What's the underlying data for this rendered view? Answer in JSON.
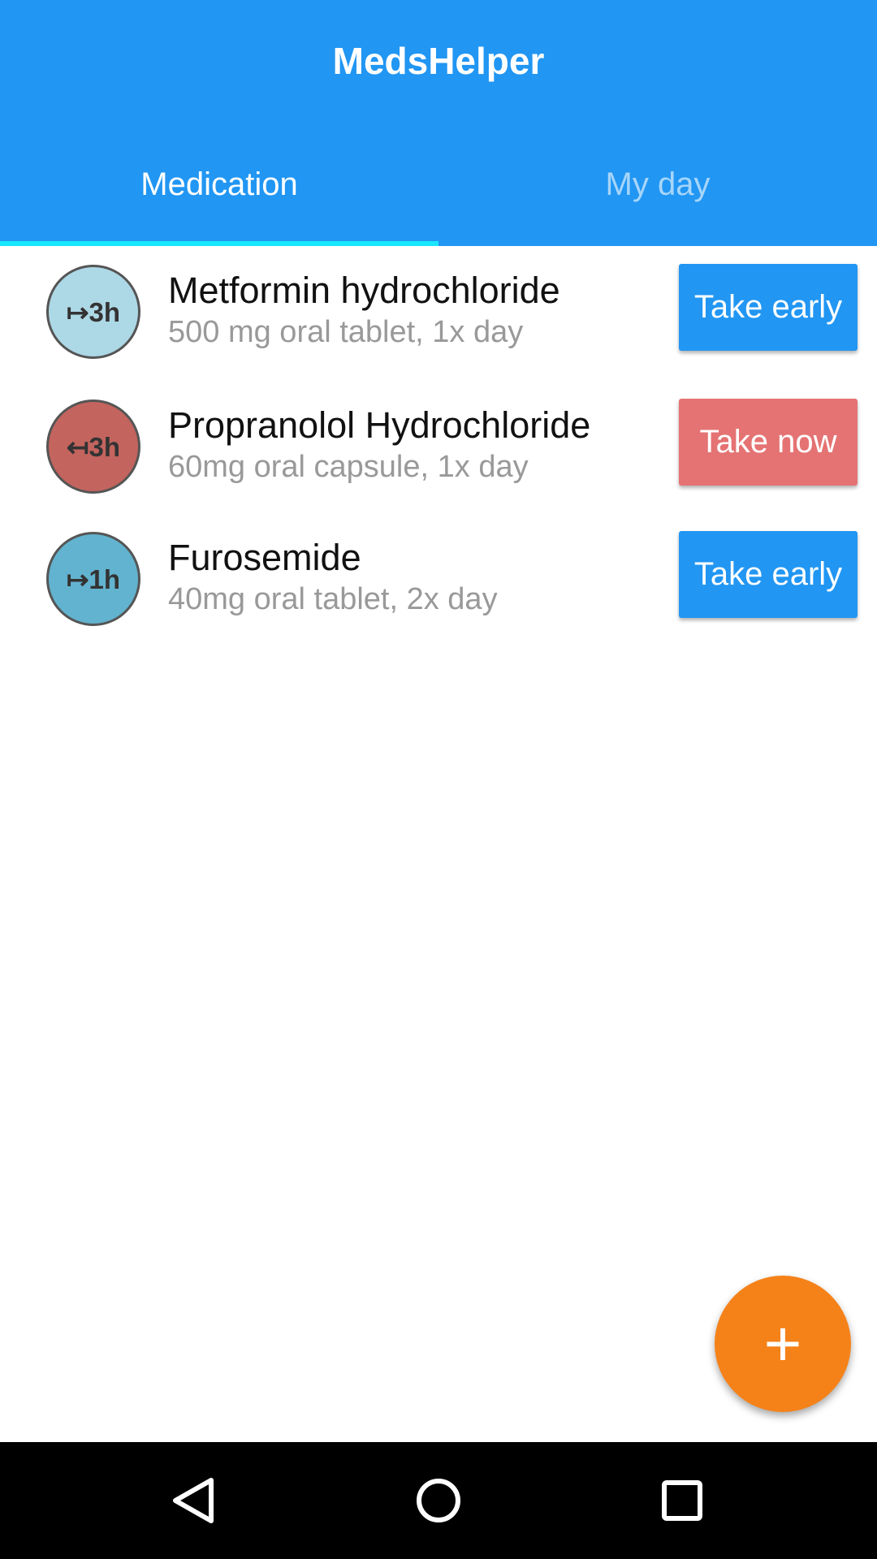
{
  "app": {
    "title": "MedsHelper"
  },
  "tabs": [
    {
      "label": "Medication",
      "active": true
    },
    {
      "label": "My day",
      "active": false
    }
  ],
  "medications": [
    {
      "badge": "↦3h",
      "name": "Metformin hydrochloride",
      "detail": "500 mg oral tablet, 1x day",
      "action": "Take early",
      "badge_color": "#ADD8E6",
      "button_color": "#2196F3"
    },
    {
      "badge": "↤3h",
      "name": "Propranolol Hydrochloride",
      "detail": "60mg oral capsule, 1x day",
      "action": "Take now",
      "badge_color": "#C4645E",
      "button_color": "#E57373"
    },
    {
      "badge": "↦1h",
      "name": "Furosemide",
      "detail": "40mg oral tablet, 2x day",
      "action": "Take early",
      "badge_color": "#62B3CF",
      "button_color": "#2196F3"
    }
  ],
  "fab": {
    "icon": "plus-icon",
    "label": "+"
  },
  "navbar": {
    "icons": [
      "back-icon",
      "home-icon",
      "recents-icon"
    ]
  }
}
